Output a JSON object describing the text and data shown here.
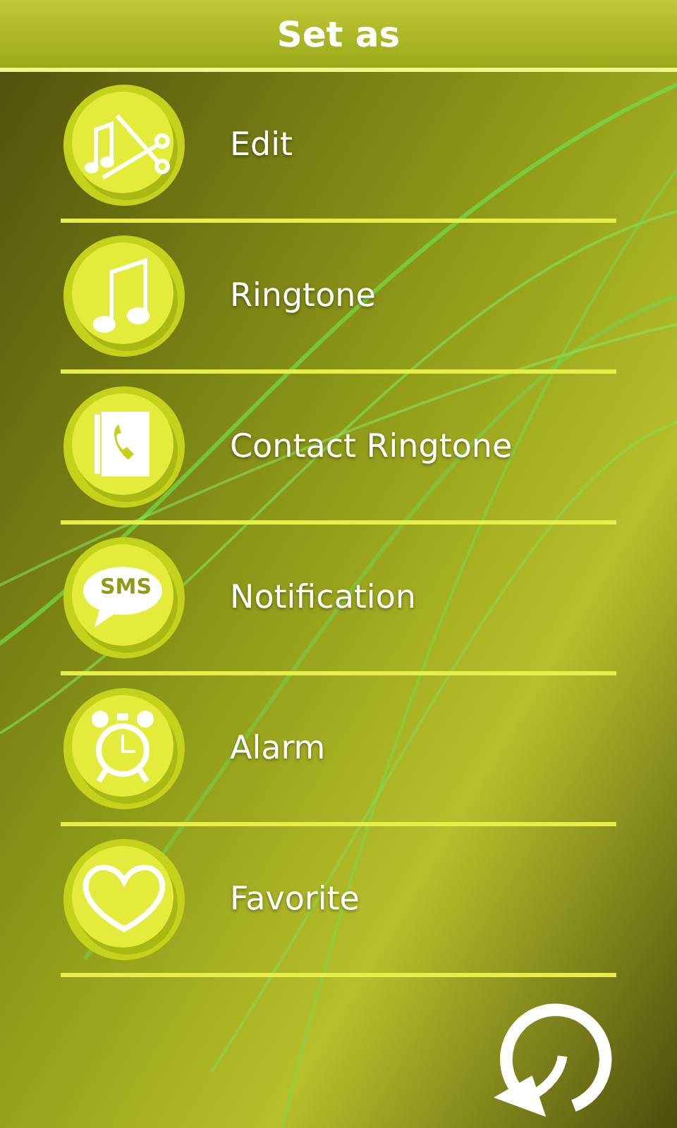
{
  "title": "Set as",
  "items": [
    {
      "kind": "edit",
      "label": "Edit"
    },
    {
      "kind": "ringtone",
      "label": "Ringtone"
    },
    {
      "kind": "contact",
      "label": "Contact Ringtone"
    },
    {
      "kind": "sms",
      "label": "Notification",
      "icon_text": "SMS"
    },
    {
      "kind": "alarm",
      "label": "Alarm"
    },
    {
      "kind": "favorite",
      "label": "Favorite"
    }
  ]
}
